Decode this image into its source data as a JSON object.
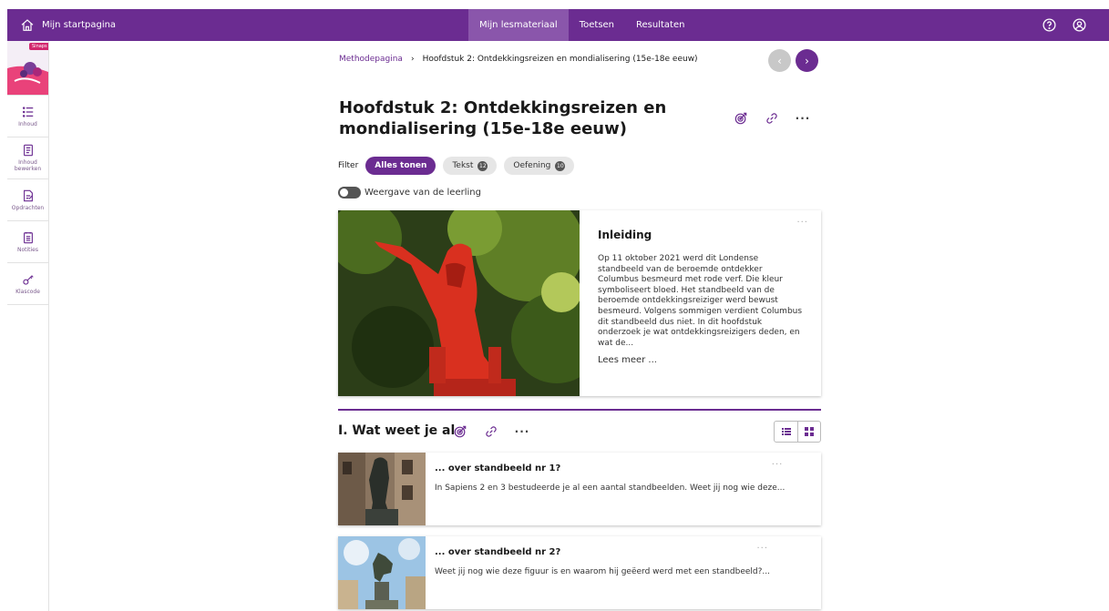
{
  "topbar": {
    "home_label": "Mijn startpagina",
    "nav": [
      {
        "label": "Mijn lesmateriaal",
        "active": true
      },
      {
        "label": "Toetsen",
        "active": false
      },
      {
        "label": "Resultaten",
        "active": false
      }
    ],
    "help_icon": "question-circle-icon",
    "user_icon": "user-circle-icon",
    "color": "#6b2c91"
  },
  "sidebar": {
    "cover_badge": "Sinaps",
    "items": [
      {
        "label": "Inhoud",
        "icon": "list-icon"
      },
      {
        "label": "Inhoud bewerken",
        "icon": "edit-list-icon"
      },
      {
        "label": "Opdrachten",
        "icon": "assignment-icon"
      },
      {
        "label": "Notities",
        "icon": "notes-icon"
      },
      {
        "label": "Klascode",
        "icon": "key-icon"
      }
    ]
  },
  "breadcrumb": {
    "root": "Methodepagina",
    "separator": "›",
    "current": "Hoofdstuk 2: Ontdekkingsreizen en mondialisering (15e-18e eeuw)"
  },
  "pager": {
    "prev": "‹",
    "next": "›"
  },
  "page": {
    "title": "Hoofdstuk 2: Ontdekkingsreizen en mondialisering (15e-18e eeuw)"
  },
  "filter": {
    "label": "Filter",
    "chips": [
      {
        "label": "Alles tonen",
        "active": true,
        "count": ""
      },
      {
        "label": "Tekst",
        "active": false,
        "count": "12"
      },
      {
        "label": "Oefening",
        "active": false,
        "count": "10"
      }
    ]
  },
  "toggle": {
    "label": "Weergave van de leerling"
  },
  "intro": {
    "title": "Inleiding",
    "text": "Op 11 oktober 2021 werd dit Londense standbeeld van de beroemde ontdekker Columbus besmeurd met rode verf. Die kleur symboliseert bloed. Het standbeeld van de beroemde ontdekkingsreiziger werd bewust besmeurd. Volgens sommigen verdient Columbus dit standbeeld dus niet. In dit hoofdstuk onderzoek je wat ontdekkingsreizigers deden, en wat de...",
    "more": "Lees meer ..."
  },
  "section": {
    "title": "I. Wat weet je al"
  },
  "lessons": [
    {
      "title": "... over standbeeld nr 1?",
      "text": "In Sapiens 2 en 3 bestudeerde je al een aantal standbeelden. Weet jij nog wie deze..."
    },
    {
      "title": "... over standbeeld nr 2?",
      "text": "Weet jij nog wie deze figuur is en waarom hij geëerd werd met een standbeeld?..."
    }
  ]
}
